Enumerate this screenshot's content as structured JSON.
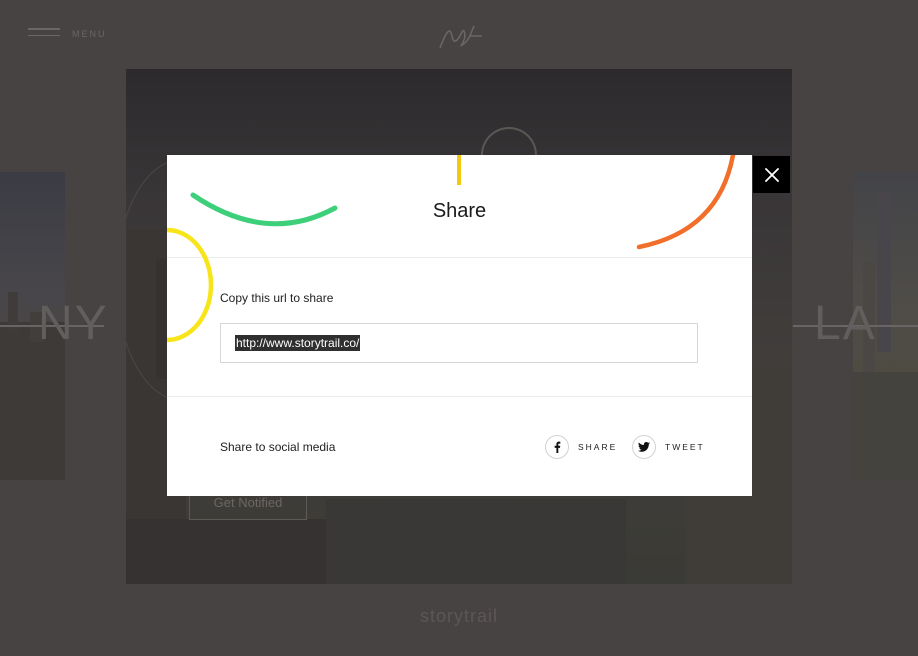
{
  "header": {
    "menu_label": "MENU",
    "logo_text": "st"
  },
  "background": {
    "city_left": "NY",
    "city_right": "LA",
    "notify_button": "Get Notified",
    "footer_brand": "storytrail"
  },
  "modal": {
    "title": "Share",
    "copy_label": "Copy this url to share",
    "url_value": "http://www.storytrail.co/",
    "social_label": "Share to social media",
    "facebook_label": "SHARE",
    "twitter_label": "TWEET",
    "facebook_icon": "facebook-icon",
    "twitter_icon": "twitter-icon",
    "close_icon": "close-icon"
  },
  "colors": {
    "overlay": "#474343",
    "modal_bg": "#ffffff",
    "green_accent": "#3ecf7a",
    "yellow_accent": "#f7e51a",
    "orange_accent": "#f26f2b",
    "close_bg": "#000000"
  }
}
